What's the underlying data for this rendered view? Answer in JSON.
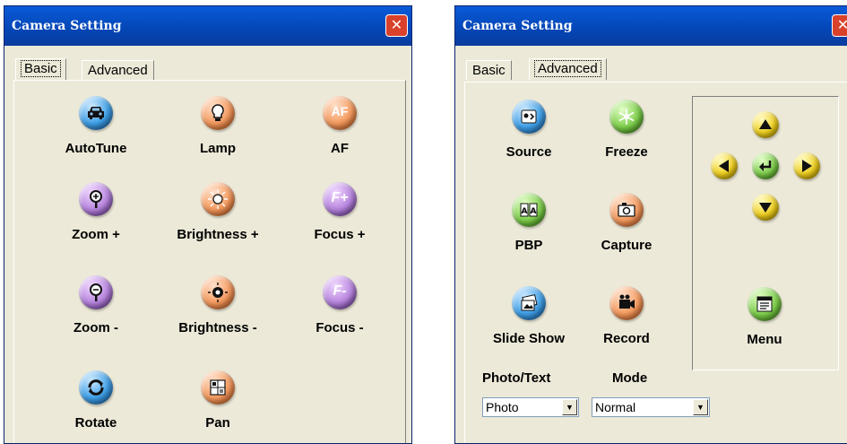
{
  "left_window": {
    "title": "Camera Setting",
    "tabs": [
      {
        "label": "Basic"
      },
      {
        "label": "Advanced"
      }
    ],
    "active_tab": "Basic",
    "items": [
      {
        "label": "AutoTune",
        "icon": "car-icon"
      },
      {
        "label": "Lamp",
        "icon": "bulb-icon"
      },
      {
        "label": "AF",
        "icon": "af-icon",
        "glyph": "AF"
      },
      {
        "label": "Zoom +",
        "icon": "zoom-in-icon"
      },
      {
        "label": "Brightness +",
        "icon": "sun-icon"
      },
      {
        "label": "Focus +",
        "icon": "focus-plus-icon",
        "glyph": "F+"
      },
      {
        "label": "Zoom -",
        "icon": "zoom-out-icon"
      },
      {
        "label": "Brightness -",
        "icon": "sun-dark-icon"
      },
      {
        "label": "Focus -",
        "icon": "focus-minus-icon",
        "glyph": "F-"
      },
      {
        "label": "Rotate",
        "icon": "rotate-icon"
      },
      {
        "label": "Pan",
        "icon": "pan-icon"
      }
    ]
  },
  "right_window": {
    "title": "Camera Setting",
    "tabs": [
      {
        "label": "Basic"
      },
      {
        "label": "Advanced"
      }
    ],
    "active_tab": "Advanced",
    "items": [
      {
        "label": "Source",
        "icon": "source-icon"
      },
      {
        "label": "Freeze",
        "icon": "snowflake-icon"
      },
      {
        "label": "PBP",
        "icon": "pbp-icon"
      },
      {
        "label": "Capture",
        "icon": "camera-icon"
      },
      {
        "label": "Slide Show",
        "icon": "slideshow-icon"
      },
      {
        "label": "Record",
        "icon": "video-camera-icon"
      }
    ],
    "menu_label": "Menu",
    "photo_text": {
      "label": "Photo/Text",
      "value": "Photo"
    },
    "mode": {
      "label": "Mode",
      "value": "Normal"
    }
  },
  "colors": {
    "titlebar": "#0447b8",
    "close": "#d9412a",
    "face": "#ece9d8"
  }
}
